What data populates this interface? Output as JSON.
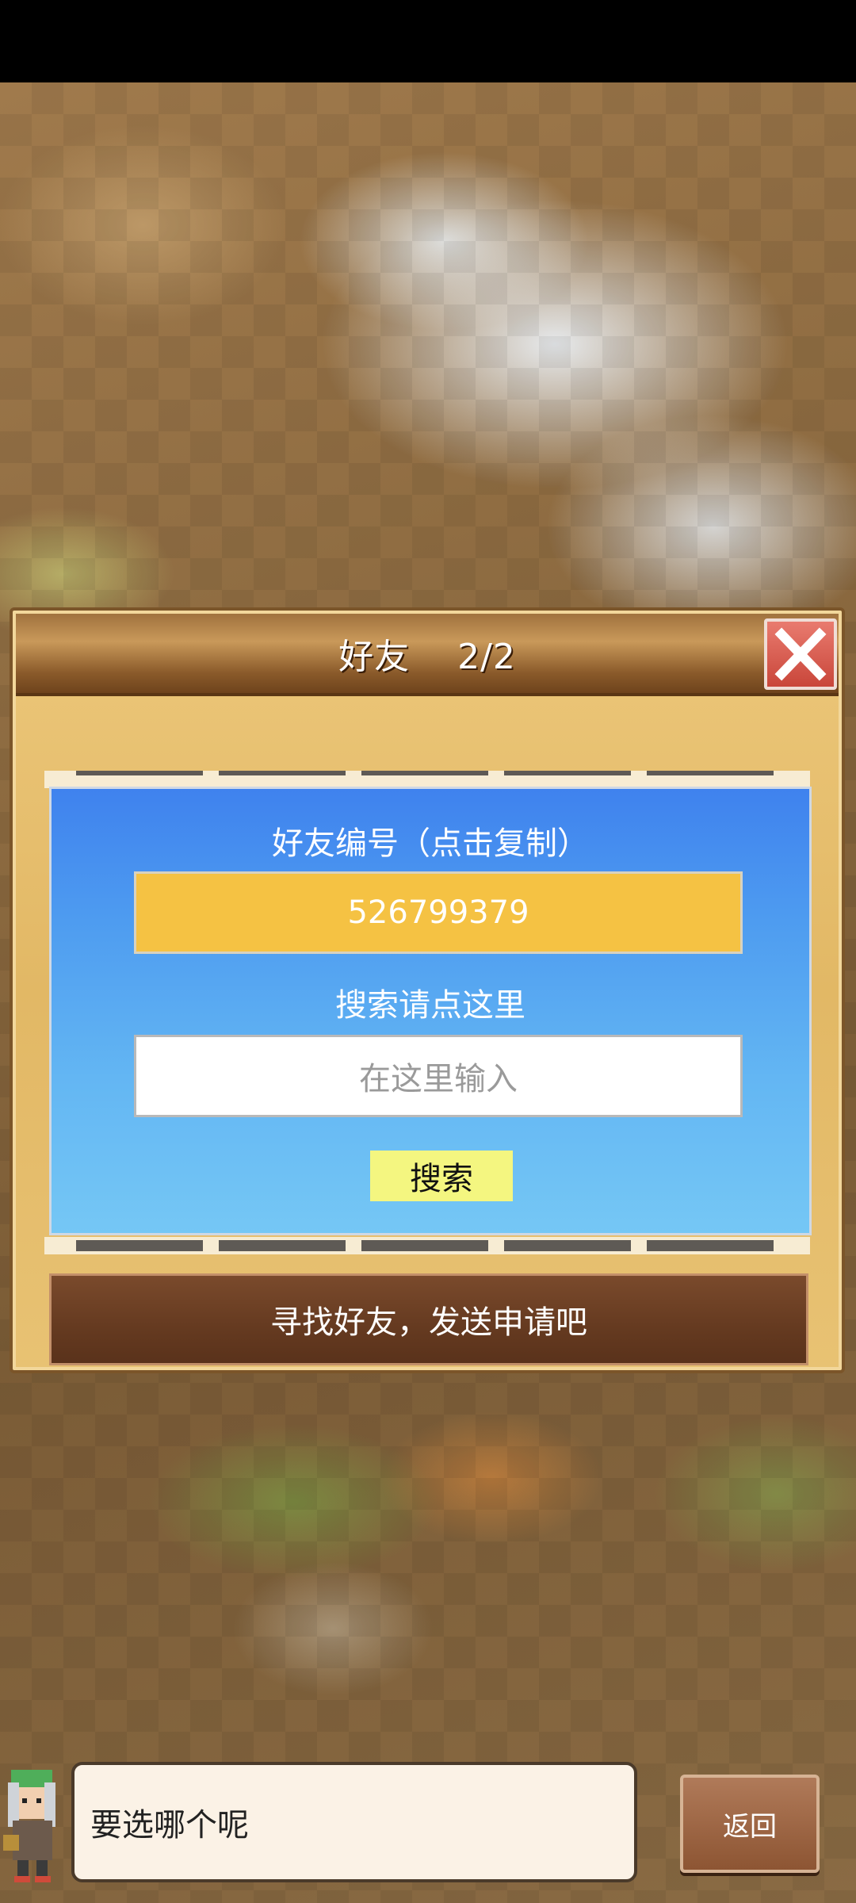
{
  "dialog": {
    "title": "好友　 2/2",
    "id_label": "好友编号（点击复制）",
    "friend_id": "526799379",
    "search_label": "搜索请点这里",
    "search_placeholder": "在这里输入",
    "search_button": "搜索",
    "footer_text": "寻找好友，发送申请吧"
  },
  "bottom": {
    "message": "要选哪个呢",
    "back_button": "返回"
  },
  "icons": {
    "close": "close-icon",
    "prev": "arrow-left-icon",
    "next": "arrow-right-icon"
  },
  "colors": {
    "id_box": "#f5c243",
    "search_button": "#f4f680",
    "panel_top": "#3f82ee",
    "panel_bottom": "#75c7f5",
    "close_button": "#d9574b"
  }
}
